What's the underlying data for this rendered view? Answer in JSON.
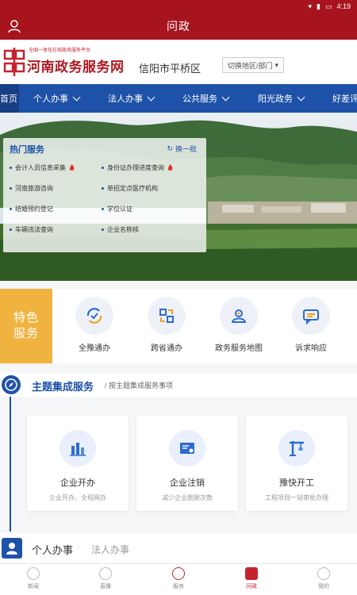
{
  "status_bar": {
    "icons": [
      "wifi-icon",
      "signal-icon",
      "battery-icon"
    ],
    "time": "4:19"
  },
  "app_bar": {
    "title": "问政"
  },
  "brand": {
    "subtitle": "全国一体化在线政务服务平台",
    "site_name": "河南政务服务网",
    "city": "信阳市平桥区",
    "switch_label": "切换地区/部门"
  },
  "nav": {
    "items": [
      {
        "label": "首页"
      },
      {
        "label": "个人办事"
      },
      {
        "label": "法人办事"
      },
      {
        "label": "公共服务"
      },
      {
        "label": "阳光政务"
      },
      {
        "label": "好差评"
      }
    ]
  },
  "hot_services": {
    "title": "热门服务",
    "refresh_label": "换一批",
    "items": [
      {
        "label": "会计人员信息采集",
        "hot": true
      },
      {
        "label": "身份证办理进度查询",
        "hot": true
      },
      {
        "label": "河南旅游咨询",
        "hot": false
      },
      {
        "label": "单招定点医疗机构",
        "hot": false
      },
      {
        "label": "结婚预约登记",
        "hot": false
      },
      {
        "label": "学位认证",
        "hot": false
      },
      {
        "label": "车辆违法查询",
        "hot": false
      },
      {
        "label": "企业名称核",
        "hot": false
      }
    ]
  },
  "featured": {
    "tag_line1": "特色",
    "tag_line2": "服务",
    "items": [
      {
        "label": "全豫通办",
        "icon": "sync-check-icon"
      },
      {
        "label": "跨省通办",
        "icon": "exchange-icon"
      },
      {
        "label": "政务服务地图",
        "icon": "map-person-icon"
      },
      {
        "label": "诉求响应",
        "icon": "chat-icon"
      }
    ]
  },
  "theme": {
    "title": "主题集成服务",
    "subtitle": "/ 按主题集成服务事项",
    "cards": [
      {
        "title": "企业开办",
        "desc": "企业开办、全程网办",
        "icon": "building-chart-icon"
      },
      {
        "title": "企业注销",
        "desc": "减少企业跑腿次数",
        "icon": "certificate-icon"
      },
      {
        "title": "豫快开工",
        "desc": "工程项目一站审批办理",
        "icon": "crane-icon"
      }
    ]
  },
  "personal": {
    "title": "个人办事",
    "secondary": "法人办事"
  },
  "tabbar": {
    "items": [
      {
        "label": "新闻",
        "active": false
      },
      {
        "label": "直播",
        "active": false
      },
      {
        "label": "服务",
        "active": false
      },
      {
        "label": "问政",
        "active": true
      },
      {
        "label": "我的",
        "active": false
      }
    ]
  },
  "colors": {
    "brand_red": "#a8141e",
    "nav_blue": "#1e52a8",
    "feature_gold": "#f0b340"
  }
}
